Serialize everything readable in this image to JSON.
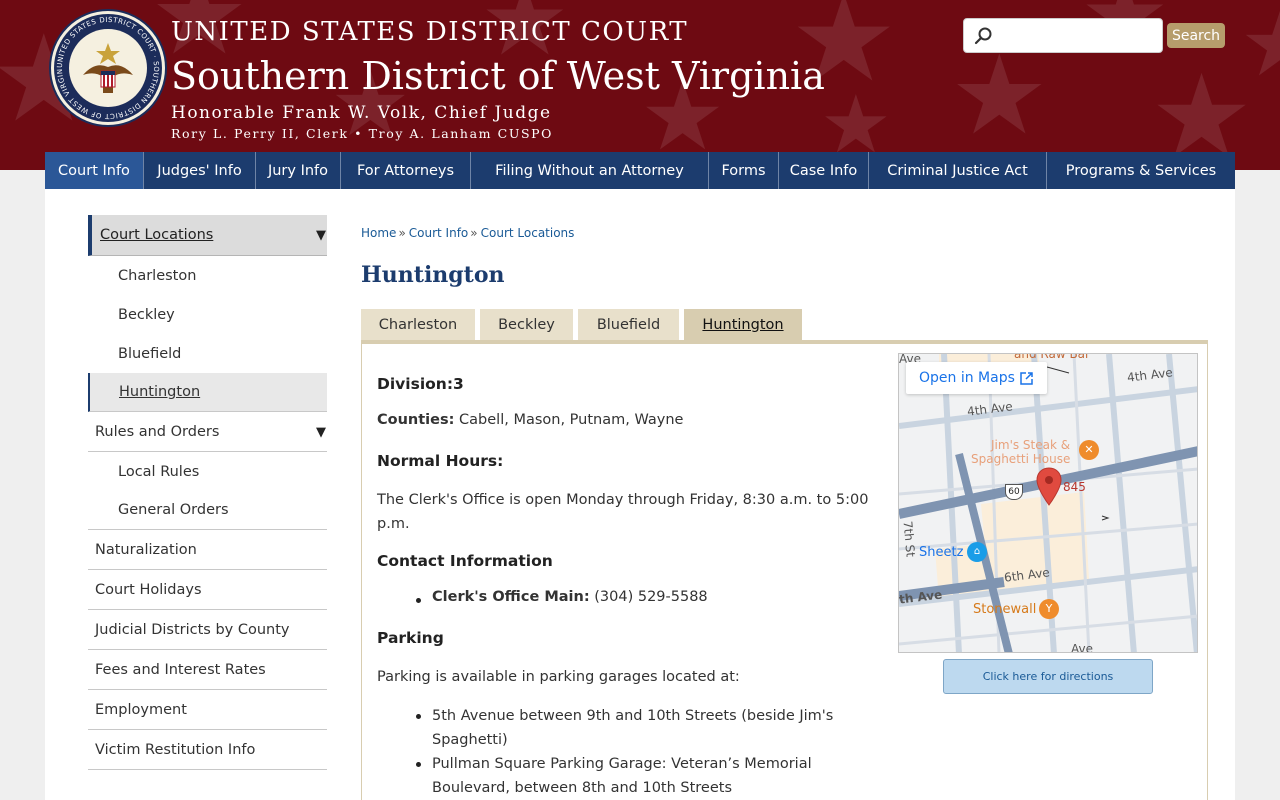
{
  "header": {
    "line1": "UNITED STATES DISTRICT COURT",
    "line2": "Southern District of West Virginia",
    "line3": "Honorable Frank W. Volk, Chief Judge",
    "line4": "Rory L. Perry II, Clerk • Troy A. Lanham CUSPO",
    "seal_text": "UNITED STATES DISTRICT COURT · SOUTHERN DISTRICT OF WEST VIRGINIA"
  },
  "search": {
    "placeholder": "",
    "value": "",
    "button_label": "Search"
  },
  "nav": {
    "items": [
      {
        "label": "Court Info"
      },
      {
        "label": "Judges' Info"
      },
      {
        "label": "Jury Info"
      },
      {
        "label": "For Attorneys"
      },
      {
        "label": "Filing Without an Attorney"
      },
      {
        "label": "Forms"
      },
      {
        "label": "Case Info"
      },
      {
        "label": "Criminal Justice Act"
      },
      {
        "label": "Programs & Services"
      }
    ],
    "active": "Court Info"
  },
  "sidebar": {
    "items": [
      {
        "label": "Court Locations"
      },
      {
        "label": "Charleston"
      },
      {
        "label": "Beckley"
      },
      {
        "label": "Bluefield"
      },
      {
        "label": "Huntington"
      },
      {
        "label": "Rules and Orders"
      },
      {
        "label": "Local Rules"
      },
      {
        "label": "General Orders"
      },
      {
        "label": "Naturalization"
      },
      {
        "label": "Court Holidays"
      },
      {
        "label": "Judicial Districts by County"
      },
      {
        "label": "Fees and Interest Rates"
      },
      {
        "label": "Employment"
      },
      {
        "label": "Victim Restitution Info"
      }
    ],
    "arrow": "▼"
  },
  "breadcrumb": {
    "items": [
      "Home",
      "Court Info",
      "Court Locations"
    ],
    "separator": "»"
  },
  "page_title": "Huntington",
  "tabs": {
    "items": [
      {
        "label": "Charleston"
      },
      {
        "label": "Beckley"
      },
      {
        "label": "Bluefield"
      },
      {
        "label": "Huntington"
      }
    ],
    "active": "Huntington"
  },
  "details": {
    "division_label": "Division:",
    "division_value": "3",
    "counties_label": "Counties:",
    "counties_value": "Cabell, Mason, Putnam, Wayne",
    "hours_heading": "Normal Hours:",
    "hours_line1": "The Clerk's Office is open Monday through Friday, 8:30 a.m. to 5:00",
    "hours_line2": "p.m.",
    "contact_heading": "Contact Information",
    "contact_label": "Clerk's Office Main:",
    "contact_value": "(304) 529-5588",
    "parking_heading": "Parking",
    "parking_intro": "Parking is available in parking garages located at:",
    "parking_items": [
      {
        "line1": "5th Avenue between 9th and 10th Streets (beside Jim's",
        "line2": "Spaghetti)"
      },
      {
        "line1": "Pullman Square Parking Garage: Veteran’s Memorial",
        "line2": "Boulevard, between 8th and 10th Streets"
      }
    ]
  },
  "map": {
    "open_maps_label": "Open in Maps",
    "labels": {
      "raw_bar": "and Raw Bar",
      "ave_top_left": "Ave",
      "fourth_ave_1": "4th Ave",
      "fourth_ave_2": "4th Ave",
      "jims_line1": "Jim's Steak &",
      "jims_line2": "Spaghetti House",
      "route": "60",
      "address_number": "845",
      "seventh_st": "7th St",
      "sheetz": "Sheetz",
      "sixth_ave": "6th Ave",
      "th_ave": "th Ave",
      "stonewall": "Stonewall",
      "bottom_ave": "Ave"
    },
    "directions_label": "Click here for directions"
  },
  "colors": {
    "header_bg": "#6e0a12",
    "nav_bg": "#1c3c6e",
    "nav_active": "#2b5797",
    "tab_bg": "#e8e0cb",
    "tab_active": "#d8cdb0",
    "link": "#1a5a96",
    "search_button": "#b69d6c"
  }
}
